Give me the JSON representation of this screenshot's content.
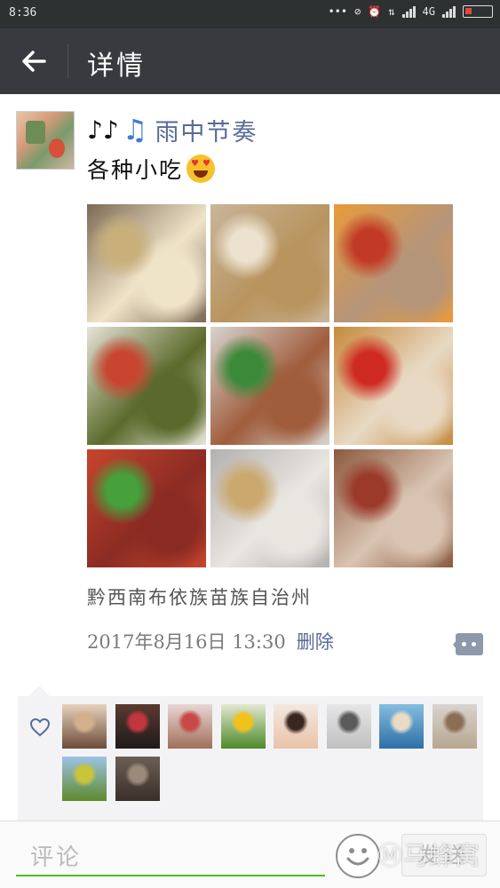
{
  "status_bar": {
    "time": "8:36",
    "network": "4G"
  },
  "app_bar": {
    "title": "详情",
    "back_icon": "arrow-left-icon"
  },
  "post": {
    "nickname_prefix_icon": "music-note-icon",
    "nickname": "雨中节奏",
    "content": "各种小吃",
    "content_emoji": "heart-eyes-emoji",
    "photos": [
      {
        "name": "tofu-platter",
        "colors": [
          "#7d6a55",
          "#efe3c8",
          "#c9b07a"
        ]
      },
      {
        "name": "fried-crisps",
        "colors": [
          "#c9b59a",
          "#b8945e",
          "#ece2cf"
        ]
      },
      {
        "name": "sauce-bowls",
        "colors": [
          "#e89a3a",
          "#b5957a",
          "#c23a25"
        ]
      },
      {
        "name": "noodle-salad",
        "colors": [
          "#e7e3d6",
          "#5b6a2c",
          "#c8452f"
        ]
      },
      {
        "name": "peanut-noodle-bowl",
        "colors": [
          "#d7d4cf",
          "#a05d3c",
          "#3b8a3a"
        ]
      },
      {
        "name": "jelly-dessert",
        "colors": [
          "#c68a3c",
          "#e8d9c4",
          "#cf2a21"
        ]
      },
      {
        "name": "beef-noodle-soup",
        "colors": [
          "#c7452d",
          "#8b2b23",
          "#46a03b"
        ]
      },
      {
        "name": "dumpling",
        "colors": [
          "#b3b0b0",
          "#e9e6e0",
          "#caa86e"
        ]
      },
      {
        "name": "tripe-soup",
        "colors": [
          "#8b5a3e",
          "#d9c4b2",
          "#9b3a2a"
        ]
      }
    ],
    "location": "黔西南布依族苗族自治州",
    "timestamp": "2017年8月16日 13:30",
    "delete_label": "删除",
    "more_icon": "comment-more-icon"
  },
  "likes": {
    "heart_icon": "heart-outline-icon",
    "avatars": [
      {
        "name": "liker-1",
        "colors": [
          "#e8d2bd",
          "#d4b08d",
          "#6d4d3a"
        ]
      },
      {
        "name": "liker-2",
        "colors": [
          "#5a3b2f",
          "#c1363f",
          "#1f1a1a"
        ]
      },
      {
        "name": "liker-3",
        "colors": [
          "#e9d6d4",
          "#c84a48",
          "#a0705a"
        ]
      },
      {
        "name": "liker-4",
        "colors": [
          "#e2e8d0",
          "#f2c21a",
          "#4d8a2b"
        ]
      },
      {
        "name": "liker-5",
        "colors": [
          "#f4e8e0",
          "#3a2620",
          "#e9c3a8"
        ]
      },
      {
        "name": "liker-6",
        "colors": [
          "#e6e6e6",
          "#5a5a5a",
          "#c0c0c0"
        ]
      },
      {
        "name": "liker-7",
        "colors": [
          "#86bde0",
          "#e8dcc7",
          "#2d6fa8"
        ]
      },
      {
        "name": "liker-8",
        "colors": [
          "#d8d4cf",
          "#8a6f55",
          "#b8a690"
        ]
      },
      {
        "name": "liker-9",
        "colors": [
          "#9ec3e6",
          "#c9c43a",
          "#5d8a2c"
        ]
      },
      {
        "name": "liker-10",
        "colors": [
          "#6b5e55",
          "#9b8a7a",
          "#3a302a"
        ]
      }
    ]
  },
  "comment_bar": {
    "placeholder": "评论",
    "emoji_icon": "smiley-icon",
    "send_label": "发送"
  },
  "watermark": "马蜂窝",
  "watermark_icon": "mafengwo-logo-icon",
  "colors": {
    "status_bar": "#2e3132",
    "app_bar": "#393a3f",
    "link": "#586a97",
    "accent_green": "#45c01a"
  }
}
